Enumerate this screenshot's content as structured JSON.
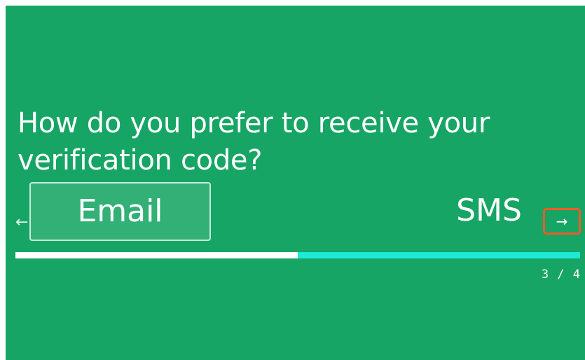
{
  "question": {
    "text": "How do you prefer to receive your verification code?"
  },
  "options": [
    {
      "label": "Email",
      "selected": true
    },
    {
      "label": "SMS",
      "selected": false
    }
  ],
  "navigation": {
    "prev_icon": "arrow-left-icon",
    "prev_glyph": "←",
    "next_icon": "arrow-right-icon",
    "next_glyph": "→"
  },
  "progress": {
    "fraction": 0.5,
    "counter_text": "3 / 4"
  },
  "colors": {
    "background": "#16a564",
    "progress_track": "#1ee8d6",
    "progress_fill": "#ffffff",
    "highlight": "#f05a28"
  }
}
